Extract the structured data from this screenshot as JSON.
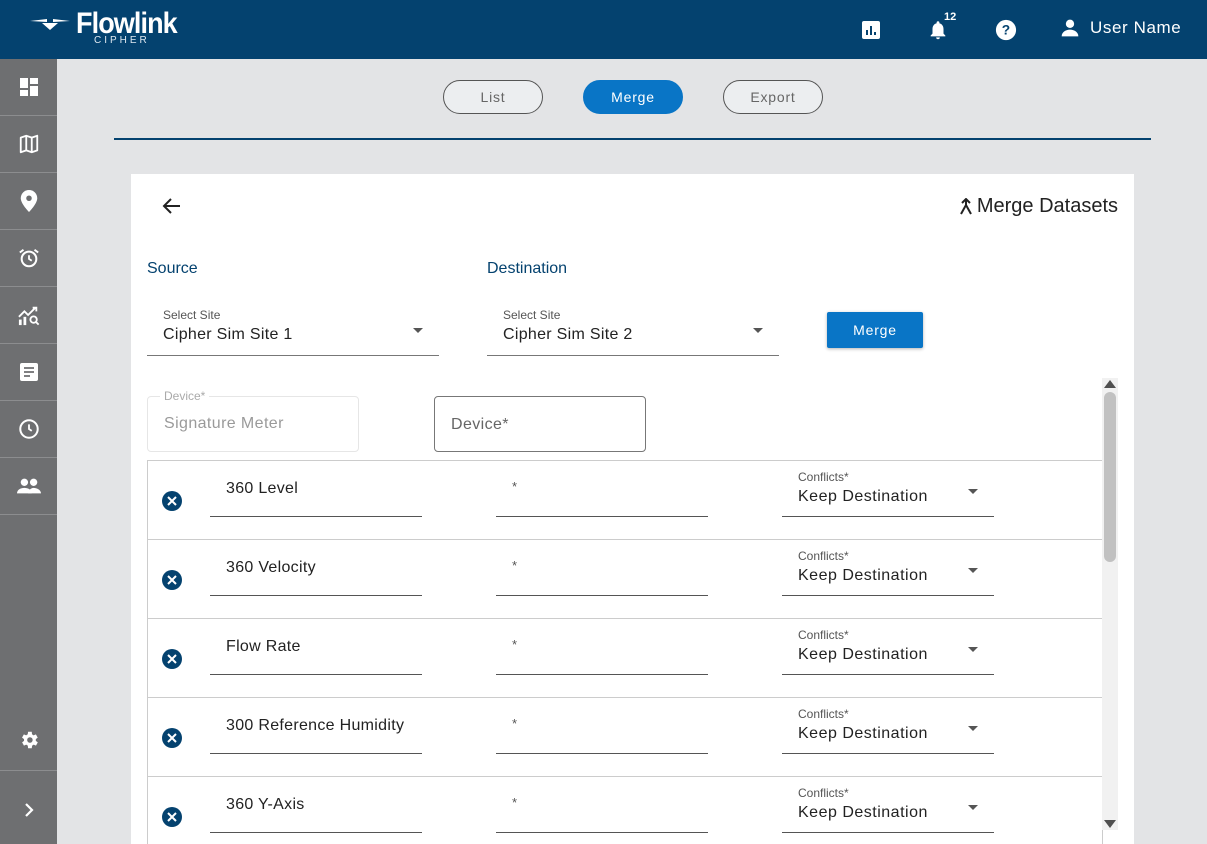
{
  "brand": {
    "name": "Flowlink",
    "sub": "CIPHER"
  },
  "header": {
    "notification_count": "12",
    "user_name": "User Name"
  },
  "sidebar": {
    "items": [
      {
        "icon": "dashboard-icon"
      },
      {
        "icon": "map-icon"
      },
      {
        "icon": "location-pin-icon"
      },
      {
        "icon": "alarm-clock-icon"
      },
      {
        "icon": "analytics-icon"
      },
      {
        "icon": "report-icon"
      },
      {
        "icon": "history-clock-icon"
      },
      {
        "icon": "users-icon"
      }
    ],
    "bottom": [
      {
        "icon": "settings-gear-icon"
      },
      {
        "icon": "expand-chevron-icon"
      }
    ]
  },
  "tabs": [
    {
      "label": "List",
      "active": false
    },
    {
      "label": "Merge",
      "active": true
    },
    {
      "label": "Export",
      "active": false
    }
  ],
  "card": {
    "title": "Merge Datasets",
    "source_label": "Source",
    "destination_label": "Destination",
    "source_site": {
      "label": "Select Site",
      "value": "Cipher Sim Site 1"
    },
    "destination_site": {
      "label": "Select Site",
      "value": "Cipher Sim Site 2"
    },
    "merge_button": "Merge",
    "source_device": {
      "label": "Device*",
      "value": "Signature Meter"
    },
    "destination_device": {
      "placeholder": "Device*"
    },
    "rows": [
      {
        "name": "360 Level",
        "dest": "*",
        "conflicts_label": "Conflicts*",
        "conflicts_value": "Keep Destination"
      },
      {
        "name": "360 Velocity",
        "dest": "*",
        "conflicts_label": "Conflicts*",
        "conflicts_value": "Keep Destination"
      },
      {
        "name": "Flow Rate",
        "dest": "*",
        "conflicts_label": "Conflicts*",
        "conflicts_value": "Keep Destination"
      },
      {
        "name": "300 Reference Humidity",
        "dest": "*",
        "conflicts_label": "Conflicts*",
        "conflicts_value": "Keep Destination"
      },
      {
        "name": "360 Y-Axis",
        "dest": "*",
        "conflicts_label": "Conflicts*",
        "conflicts_value": "Keep Destination"
      }
    ]
  },
  "colors": {
    "header": "#04426f",
    "accent": "#0975c6",
    "sidebar": "#6e6f71"
  }
}
